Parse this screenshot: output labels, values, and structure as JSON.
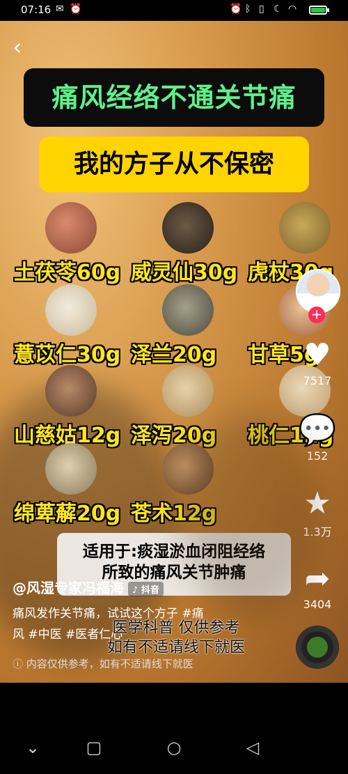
{
  "status_bar": {
    "time": "07:16",
    "left_icons": [
      "message-icon",
      "alarm-icon"
    ],
    "right_icons": [
      "alarm-icon",
      "bluetooth-icon",
      "vibrate-icon",
      "moon-icon",
      "wifi-icon"
    ],
    "battery_level": 0.9
  },
  "video": {
    "title": "痛风经络不通关节痛",
    "subtitle": "我的方子从不保密",
    "herbs": [
      {
        "label": "土茯苓60g"
      },
      {
        "label": "威灵仙30g"
      },
      {
        "label": "虎杖30g"
      },
      {
        "label": "薏苡仁30g"
      },
      {
        "label": "泽兰20g"
      },
      {
        "label": "甘草5g"
      },
      {
        "label": "山慈姑12g"
      },
      {
        "label": "泽泻20g"
      },
      {
        "label": "桃仁12g"
      },
      {
        "label": "绵萆薢20g"
      },
      {
        "label": "苍术12g"
      }
    ],
    "caption_line1": "适用于:痰湿淤血闭阻经络",
    "caption_line2": "所致的痛风关节肿痛",
    "watermark_line1": "医学科普  仅供参考",
    "watermark_line2": "如有不适请线下就医"
  },
  "rail": {
    "likes": "7517",
    "comments": "152",
    "favorites": "1.3万",
    "shares": "3404"
  },
  "post": {
    "author": "@风湿专家冯福海",
    "platform_badge": "抖音",
    "description_line1": "痛风发作关节痛，试试这个方子 #痛",
    "description_line2": "风 #中医 #医者仁心",
    "notice": "内容仅供参考，如有不适请线下就医"
  }
}
